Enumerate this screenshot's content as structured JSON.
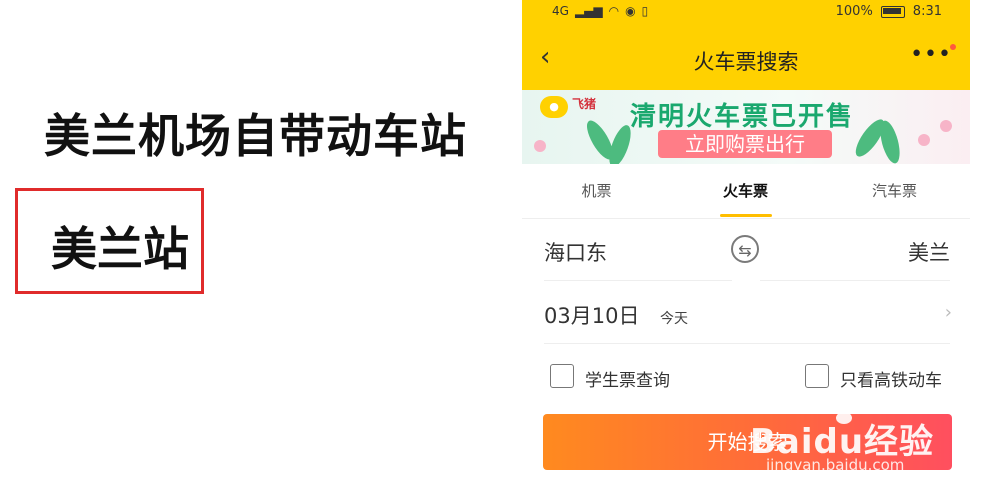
{
  "left": {
    "headline": "美兰机场自带动车站",
    "highlight_text": "美兰站"
  },
  "status_bar": {
    "network": "4G",
    "battery_pct": "100%",
    "time": "8:31"
  },
  "header": {
    "title": "火车票搜索",
    "back_icon": "chevron-left-icon",
    "more_icon": "more-dots-icon"
  },
  "banner": {
    "brand": "飞猪",
    "title": "清明火车票已开售",
    "button": "立即购票出行"
  },
  "tabs": [
    {
      "label": "机票",
      "active": false
    },
    {
      "label": "火车票",
      "active": true
    },
    {
      "label": "汽车票",
      "active": false
    }
  ],
  "route": {
    "from": "海口东",
    "to": "美兰",
    "swap_icon": "swap-icon"
  },
  "date": {
    "value": "03月10日",
    "hint": "今天"
  },
  "options": {
    "student_label": "学生票查询",
    "highspeed_label": "只看高铁动车"
  },
  "search_button": "开始搜索",
  "watermark": {
    "logo": "Baidu经验",
    "url": "jingyan.baidu.com"
  },
  "colors": {
    "header_yellow": "#ffd100",
    "tab_indicator": "#ffbe00",
    "highlight_red": "#e02b2b",
    "search_gradient_start": "#ff8a1f",
    "search_gradient_end": "#ff4f5f"
  }
}
